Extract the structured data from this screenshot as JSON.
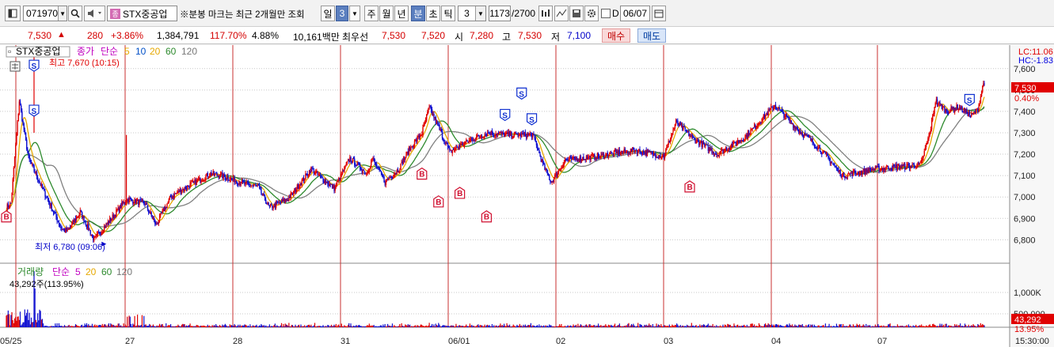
{
  "toolbar": {
    "code": "071970",
    "name": "STX중공업",
    "notice": "※분봉 마크는 최근 2개월만 조회",
    "period_buttons": [
      "일",
      "3",
      "주",
      "월",
      "년",
      "분",
      "초",
      "틱"
    ],
    "interval": "3",
    "count": "1173",
    "count_total": "/2700",
    "date": "06/07",
    "d_label": "D",
    "icons": [
      "window-icon",
      "search-icon",
      "speaker-icon",
      "chart-tools-icon",
      "line-tools-icon",
      "save-icon",
      "settings-icon"
    ]
  },
  "quote": {
    "price": "7,530",
    "arrow": "▲",
    "change": "280",
    "rate": "+3.86%",
    "volume": "1,384,791",
    "vol_ratio": "117.70%",
    "turnover": "4.88%",
    "amount": "10,161백만",
    "best": "최우선",
    "ask": "7,530",
    "bid": "7,520",
    "open_label": "시",
    "open": "7,280",
    "high_label": "고",
    "high": "7,530",
    "low_label": "저",
    "low": "7,100",
    "buy_btn": "매수",
    "sell_btn": "매도"
  },
  "price_panel": {
    "title": "STX중공업",
    "series_label": "종가",
    "ma_label": "단순",
    "ma": [
      "5",
      "10",
      "20",
      "60",
      "120"
    ],
    "lc": "LC:11.06",
    "hc": "HC:-1.83",
    "hi_note": "최고 7,670 (10:15)",
    "lo_note": "최저 6,780 (09:06)",
    "price_tag": "7,530",
    "pct_tag": "0.40%"
  },
  "volume_panel": {
    "title": "거래량",
    "ma_label": "단순",
    "ma": [
      "5",
      "20",
      "60",
      "120"
    ],
    "value_note": "43,292주(113.95%)",
    "vol_tag": "43,292",
    "vol_pct_tag": "13.95%"
  },
  "colors": {
    "up": "#e00000",
    "down": "#1010d0",
    "ma5": "#e6a800",
    "ma10": "#2d8a2d",
    "ma20": "#808080",
    "grid": "#c8c8c8",
    "day_line": "#c83232"
  },
  "chart_data": {
    "type": "candlestick",
    "ylim": [
      6720,
      7710
    ],
    "y_ticks": [
      "7,600",
      "7,500",
      "7,400",
      "7,300",
      "7,200",
      "7,100",
      "7,000",
      "6,900",
      "6,800"
    ],
    "vol_ticks": [
      "1,000K",
      "500,000"
    ],
    "x_labels": [
      "05/25",
      "27",
      "28",
      "31",
      "06/01",
      "02",
      "03",
      "04",
      "07"
    ],
    "last_time": "15:30:00",
    "anchors": [
      [
        0,
        6950
      ],
      [
        5,
        6970
      ],
      [
        14,
        7450
      ],
      [
        24,
        7180
      ],
      [
        40,
        7030
      ],
      [
        60,
        6850
      ],
      [
        66,
        6840
      ],
      [
        80,
        6930
      ],
      [
        95,
        6800
      ],
      [
        112,
        6890
      ],
      [
        130,
        6990
      ],
      [
        150,
        6970
      ],
      [
        162,
        6870
      ],
      [
        178,
        7000
      ],
      [
        200,
        7060
      ],
      [
        222,
        7110
      ],
      [
        240,
        7090
      ],
      [
        258,
        7060
      ],
      [
        272,
        7050
      ],
      [
        285,
        6950
      ],
      [
        305,
        6990
      ],
      [
        330,
        7130
      ],
      [
        355,
        7040
      ],
      [
        372,
        7180
      ],
      [
        390,
        7110
      ],
      [
        396,
        7180
      ],
      [
        410,
        7070
      ],
      [
        425,
        7130
      ],
      [
        436,
        7220
      ],
      [
        450,
        7300
      ],
      [
        458,
        7420
      ],
      [
        475,
        7260
      ],
      [
        480,
        7210
      ],
      [
        495,
        7250
      ],
      [
        510,
        7280
      ],
      [
        522,
        7300
      ],
      [
        550,
        7290
      ],
      [
        570,
        7290
      ],
      [
        582,
        7140
      ],
      [
        590,
        7070
      ],
      [
        605,
        7170
      ],
      [
        640,
        7190
      ],
      [
        680,
        7220
      ],
      [
        712,
        7190
      ],
      [
        725,
        7350
      ],
      [
        745,
        7270
      ],
      [
        770,
        7200
      ],
      [
        800,
        7280
      ],
      [
        832,
        7430
      ],
      [
        858,
        7310
      ],
      [
        870,
        7270
      ],
      [
        890,
        7180
      ],
      [
        905,
        7100
      ],
      [
        940,
        7130
      ],
      [
        990,
        7150
      ],
      [
        1000,
        7300
      ],
      [
        1006,
        7450
      ],
      [
        1018,
        7400
      ],
      [
        1031,
        7420
      ],
      [
        1045,
        7380
      ],
      [
        1052,
        7410
      ],
      [
        1058,
        7530
      ]
    ],
    "markers": [
      {
        "t": "S",
        "i": 30,
        "p": 7580
      },
      {
        "t": "S",
        "i": 30,
        "p": 7370
      },
      {
        "t": "B",
        "i": 0,
        "p": 6950
      },
      {
        "t": "B",
        "i": 450,
        "p": 7150
      },
      {
        "t": "B",
        "i": 468,
        "p": 7020
      },
      {
        "t": "B",
        "i": 491,
        "p": 7060
      },
      {
        "t": "B",
        "i": 520,
        "p": 6950
      },
      {
        "t": "S",
        "i": 540,
        "p": 7350
      },
      {
        "t": "S",
        "i": 558,
        "p": 7450
      },
      {
        "t": "S",
        "i": 569,
        "p": 7330
      },
      {
        "t": "B",
        "i": 740,
        "p": 7090
      },
      {
        "t": "S",
        "i": 1043,
        "p": 7420
      }
    ]
  }
}
